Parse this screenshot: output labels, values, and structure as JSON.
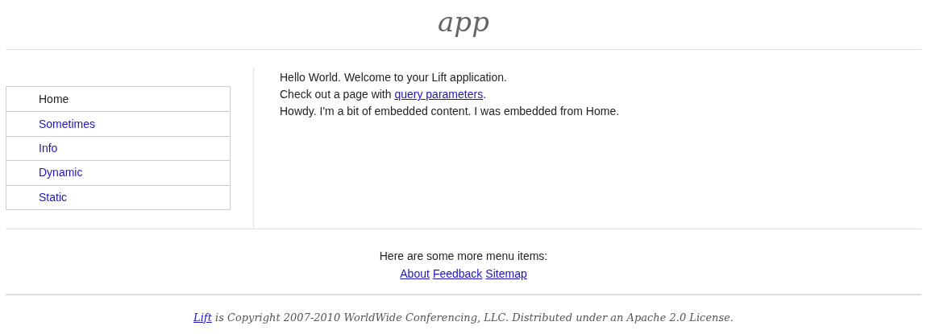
{
  "title": "app",
  "sidebar": {
    "items": [
      {
        "label": "Home",
        "selected": true
      },
      {
        "label": "Sometimes",
        "selected": false
      },
      {
        "label": "Info",
        "selected": false
      },
      {
        "label": "Dynamic",
        "selected": false
      },
      {
        "label": "Static",
        "selected": false
      }
    ]
  },
  "content": {
    "lines": [
      {
        "text": "Hello World. Welcome to your Lift application."
      },
      {
        "text": "Check out a page with",
        "link": "query parameters",
        "after": "."
      },
      {
        "text": "Howdy. I'm a bit of embedded content. I was embedded from Home."
      }
    ]
  },
  "more_menu": {
    "heading": "Here are some more menu items:",
    "links": [
      "About",
      "Feedback",
      "Sitemap"
    ]
  },
  "footer": {
    "link": "Lift",
    "text": "is Copyright 2007-2010 WorldWide Conferencing, LLC. Distributed under an Apache 2.0 License."
  }
}
